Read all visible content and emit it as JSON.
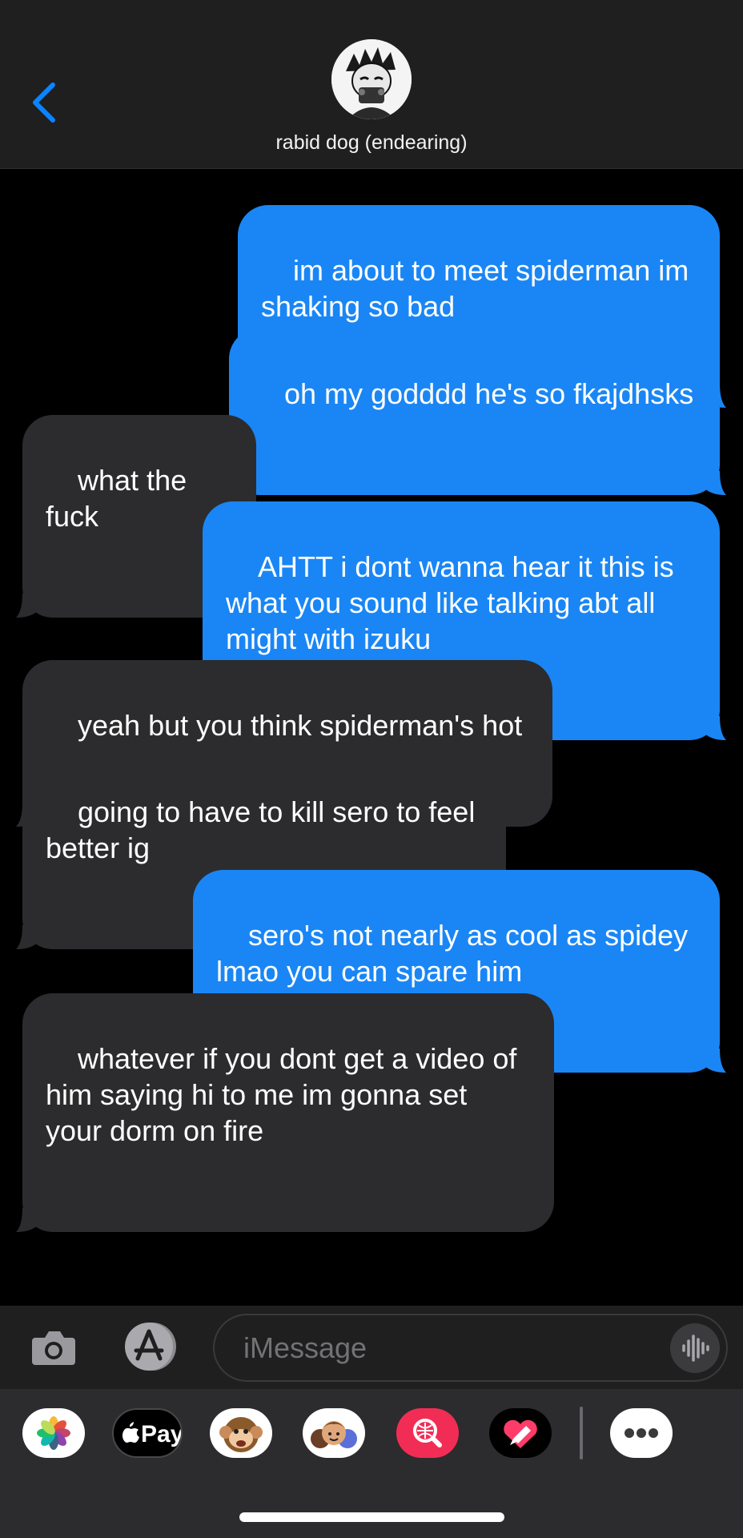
{
  "header": {
    "contact_name": "rabid dog (endearing)"
  },
  "messages": [
    {
      "type": "sent",
      "text": "im about to meet spiderman im\nshaking so bad"
    },
    {
      "type": "sent",
      "text": "oh my godddd he's so fkajdhsks"
    },
    {
      "type": "received",
      "text": "what the fuck"
    },
    {
      "type": "sent",
      "text": "AHTT i dont wanna hear it this is\nwhat you sound like talking abt all\nmight with izuku"
    },
    {
      "type": "received",
      "text": "yeah but you think spiderman's hot"
    },
    {
      "type": "received",
      "text": "going to have to kill sero to feel\nbetter ig"
    },
    {
      "type": "sent",
      "text": "sero's not nearly as cool as spidey\nlmao you can spare him"
    },
    {
      "type": "received",
      "text": "whatever if you dont get a video of\nhim saying hi to me im gonna set\nyour dorm on fire"
    }
  ],
  "input": {
    "placeholder": "iMessage"
  },
  "tray": {
    "apple_pay_label": "Pay",
    "apps": [
      "photos-icon",
      "apple-pay-icon",
      "animoji-icon",
      "memoji-stickers-icon",
      "images-search-icon",
      "digital-touch-icon",
      "more-apps-icon"
    ]
  },
  "colors": {
    "sent_bubble": "#1a86f5",
    "received_bubble": "#2c2c2e",
    "accent": "#0a84ff"
  }
}
